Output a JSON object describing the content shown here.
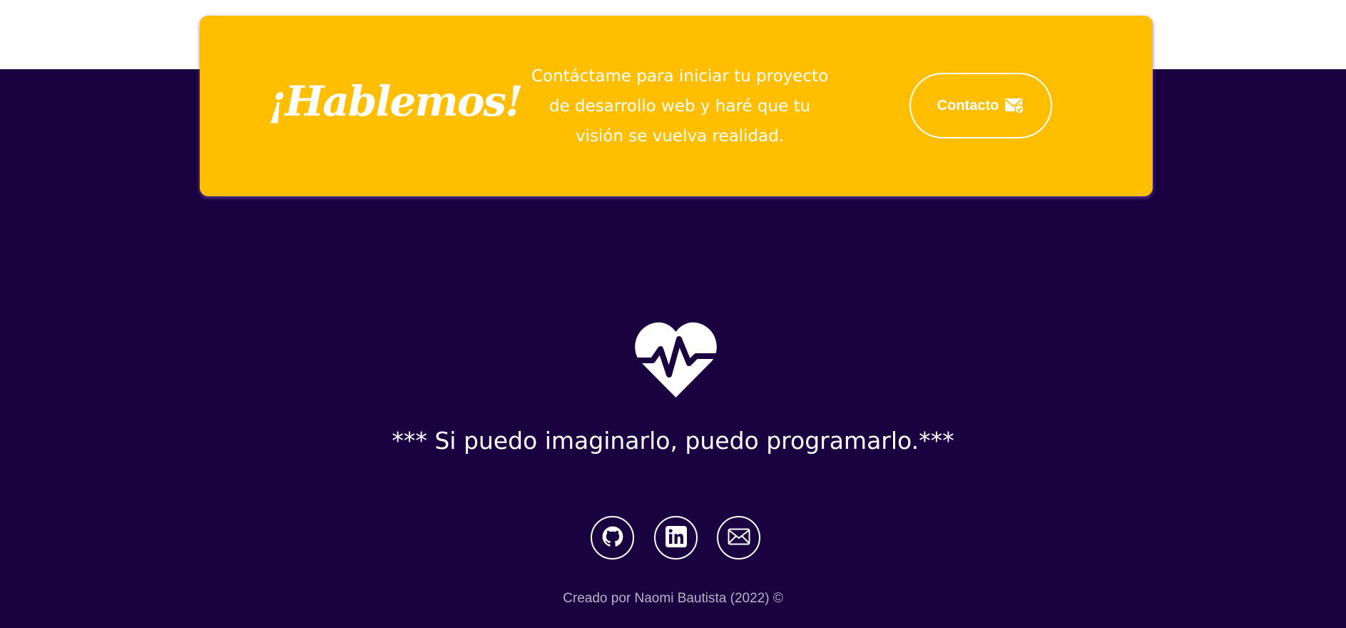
{
  "cta": {
    "title": "¡Hablemos!",
    "text": "Contáctame para iniciar tu proyecto de desarrollo web y haré que tu visión se vuelva realidad.",
    "button_label": "Contacto",
    "button_icon": "mail-check-icon"
  },
  "hero": {
    "icon": "heart-pulse-icon",
    "motto": "*** Si puedo imaginarlo, puedo programarlo.***"
  },
  "socials": [
    {
      "name": "GitHub",
      "icon": "github-icon"
    },
    {
      "name": "LinkedIn",
      "icon": "linkedin-icon"
    },
    {
      "name": "Email",
      "icon": "envelope-icon"
    }
  ],
  "footer": {
    "credit": "Creado por Naomi Bautista (2022) ©"
  },
  "colors": {
    "accent": "#ffbf00",
    "background": "#1a0140",
    "text": "#ffffff"
  }
}
